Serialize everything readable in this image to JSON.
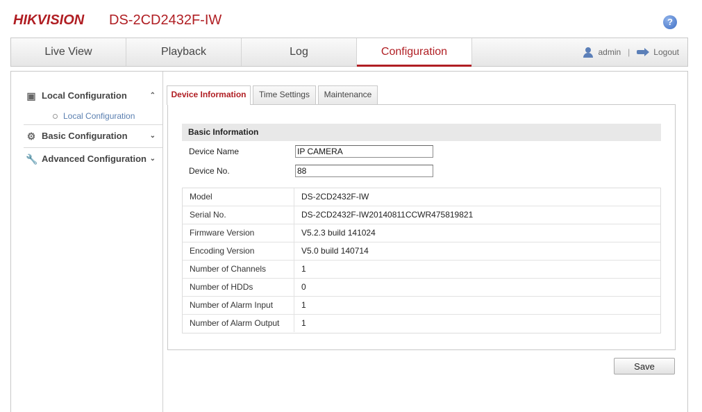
{
  "header": {
    "brand": "HIKVISION",
    "model": "DS-2CD2432F-IW",
    "help_icon": "?"
  },
  "nav": {
    "tabs": [
      {
        "label": "Live View",
        "active": false
      },
      {
        "label": "Playback",
        "active": false
      },
      {
        "label": "Log",
        "active": false
      },
      {
        "label": "Configuration",
        "active": true
      }
    ],
    "user": "admin",
    "separator": "|",
    "logout": "Logout",
    "accent_color": "#b01e23"
  },
  "sidebar": {
    "sections": [
      {
        "label": "Local Configuration",
        "icon": "monitor-icon",
        "expanded": true,
        "chevron": "^"
      },
      {
        "label": "Basic Configuration",
        "icon": "gear-icon",
        "expanded": false,
        "chevron": "v"
      },
      {
        "label": "Advanced Configuration",
        "icon": "wrench-icon",
        "expanded": false,
        "chevron": "v"
      }
    ],
    "sub_item": "Local Configuration"
  },
  "content": {
    "tabs": [
      {
        "label": "Device Information",
        "active": true
      },
      {
        "label": "Time Settings",
        "active": false
      },
      {
        "label": "Maintenance",
        "active": false
      }
    ],
    "basic_header": "Basic Information",
    "device_name_label": "Device Name",
    "device_name_value": "IP CAMERA",
    "device_no_label": "Device No.",
    "device_no_value": "88",
    "info": [
      {
        "key": "Model",
        "value": "DS-2CD2432F-IW"
      },
      {
        "key": "Serial No.",
        "value": "DS-2CD2432F-IW20140811CCWR475819821"
      },
      {
        "key": "Firmware Version",
        "value": "V5.2.3 build 141024"
      },
      {
        "key": "Encoding Version",
        "value": "V5.0 build 140714"
      },
      {
        "key": "Number of Channels",
        "value": "1"
      },
      {
        "key": "Number of HDDs",
        "value": "0"
      },
      {
        "key": "Number of Alarm Input",
        "value": "1"
      },
      {
        "key": "Number of Alarm Output",
        "value": "1"
      }
    ],
    "save_label": "Save"
  }
}
